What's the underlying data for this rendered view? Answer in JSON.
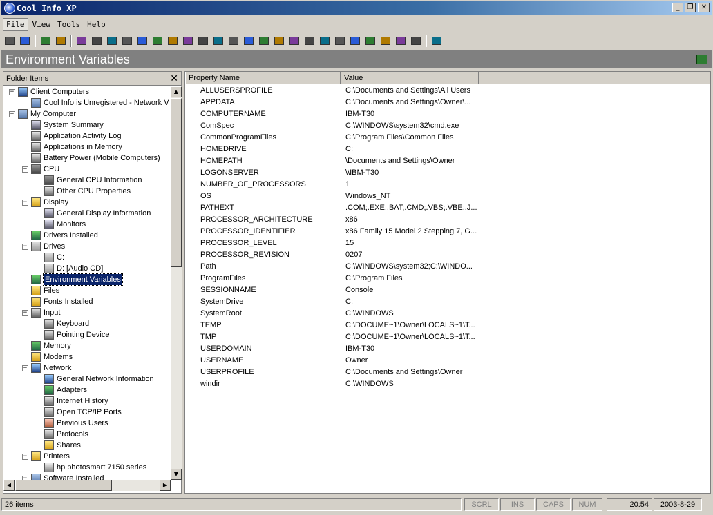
{
  "window": {
    "title": "Cool Info XP",
    "buttons": {
      "minimize": "_",
      "restore": "❐",
      "close": "✕"
    }
  },
  "menu": [
    "File",
    "View",
    "Tools",
    "Help"
  ],
  "header": {
    "title": "Environment Variables"
  },
  "left_pane": {
    "title": "Folder Items",
    "close_glyph": "✕",
    "tree": [
      {
        "label": "Client Computers",
        "level": 0,
        "expander": "−",
        "icon": "ic-network"
      },
      {
        "label": "Cool Info is Unregistered - Network V",
        "level": 1,
        "expander": "",
        "icon": "ic-computer"
      },
      {
        "label": "My Computer",
        "level": 0,
        "expander": "−",
        "icon": "ic-computer"
      },
      {
        "label": "System Summary",
        "level": 1,
        "expander": "",
        "icon": "ic-monitor"
      },
      {
        "label": "Application Activity Log",
        "level": 1,
        "expander": "",
        "icon": "ic-app"
      },
      {
        "label": "Applications in Memory",
        "level": 1,
        "expander": "",
        "icon": "ic-app"
      },
      {
        "label": "Battery Power (Mobile Computers)",
        "level": 1,
        "expander": "",
        "icon": "ic-app"
      },
      {
        "label": "CPU",
        "level": 1,
        "expander": "−",
        "icon": "ic-chip"
      },
      {
        "label": "General CPU Information",
        "level": 2,
        "expander": "",
        "icon": "ic-chip"
      },
      {
        "label": "Other CPU Properties",
        "level": 2,
        "expander": "",
        "icon": "ic-app"
      },
      {
        "label": "Display",
        "level": 1,
        "expander": "−",
        "icon": "ic-folder"
      },
      {
        "label": "General Display Information",
        "level": 2,
        "expander": "",
        "icon": "ic-monitor"
      },
      {
        "label": "Monitors",
        "level": 2,
        "expander": "",
        "icon": "ic-monitor"
      },
      {
        "label": "Drivers Installed",
        "level": 1,
        "expander": "",
        "icon": "ic-green"
      },
      {
        "label": "Drives",
        "level": 1,
        "expander": "−",
        "icon": "ic-drive"
      },
      {
        "label": "C:",
        "level": 2,
        "expander": "",
        "icon": "ic-drive"
      },
      {
        "label": "D: [Audio CD]",
        "level": 2,
        "expander": "",
        "icon": "ic-drive"
      },
      {
        "label": "Environment Variables",
        "level": 1,
        "expander": "",
        "icon": "ic-green",
        "selected": true
      },
      {
        "label": "Files",
        "level": 1,
        "expander": "",
        "icon": "ic-folder"
      },
      {
        "label": "Fonts Installed",
        "level": 1,
        "expander": "",
        "icon": "ic-folder"
      },
      {
        "label": "Input",
        "level": 1,
        "expander": "−",
        "icon": "ic-app"
      },
      {
        "label": "Keyboard",
        "level": 2,
        "expander": "",
        "icon": "ic-app"
      },
      {
        "label": "Pointing Device",
        "level": 2,
        "expander": "",
        "icon": "ic-app"
      },
      {
        "label": "Memory",
        "level": 1,
        "expander": "",
        "icon": "ic-green"
      },
      {
        "label": "Modems",
        "level": 1,
        "expander": "",
        "icon": "ic-folder"
      },
      {
        "label": "Network",
        "level": 1,
        "expander": "−",
        "icon": "ic-network"
      },
      {
        "label": "General Network Information",
        "level": 2,
        "expander": "",
        "icon": "ic-network"
      },
      {
        "label": "Adapters",
        "level": 2,
        "expander": "",
        "icon": "ic-green"
      },
      {
        "label": "Internet History",
        "level": 2,
        "expander": "",
        "icon": "ic-app"
      },
      {
        "label": "Open TCP/IP Ports",
        "level": 2,
        "expander": "",
        "icon": "ic-app"
      },
      {
        "label": "Previous Users",
        "level": 2,
        "expander": "",
        "icon": "ic-user"
      },
      {
        "label": "Protocols",
        "level": 2,
        "expander": "",
        "icon": "ic-app"
      },
      {
        "label": "Shares",
        "level": 2,
        "expander": "",
        "icon": "ic-folder"
      },
      {
        "label": "Printers",
        "level": 1,
        "expander": "−",
        "icon": "ic-folder"
      },
      {
        "label": "hp photosmart 7150 series",
        "level": 2,
        "expander": "",
        "icon": "ic-printer"
      },
      {
        "label": "Software Installed",
        "level": 1,
        "expander": "−",
        "icon": "ic-computer"
      }
    ],
    "scroll": {
      "up": "▲",
      "down": "▼",
      "left": "◀",
      "right": "▶"
    }
  },
  "table": {
    "columns": [
      "Property Name",
      "Value"
    ],
    "rows": [
      [
        "ALLUSERSPROFILE",
        "C:\\Documents and Settings\\All Users"
      ],
      [
        "APPDATA",
        "C:\\Documents and Settings\\Owner\\..."
      ],
      [
        "COMPUTERNAME",
        "IBM-T30"
      ],
      [
        "ComSpec",
        "C:\\WINDOWS\\system32\\cmd.exe"
      ],
      [
        "CommonProgramFiles",
        "C:\\Program Files\\Common Files"
      ],
      [
        "HOMEDRIVE",
        "C:"
      ],
      [
        "HOMEPATH",
        "\\Documents and Settings\\Owner"
      ],
      [
        "LOGONSERVER",
        "\\\\IBM-T30"
      ],
      [
        "NUMBER_OF_PROCESSORS",
        "1"
      ],
      [
        "OS",
        "Windows_NT"
      ],
      [
        "PATHEXT",
        ".COM;.EXE;.BAT;.CMD;.VBS;.VBE;.J..."
      ],
      [
        "PROCESSOR_ARCHITECTURE",
        "x86"
      ],
      [
        "PROCESSOR_IDENTIFIER",
        "x86 Family 15 Model 2 Stepping 7, G..."
      ],
      [
        "PROCESSOR_LEVEL",
        "15"
      ],
      [
        "PROCESSOR_REVISION",
        "0207"
      ],
      [
        "Path",
        "C:\\WINDOWS\\system32;C:\\WINDO..."
      ],
      [
        "ProgramFiles",
        "C:\\Program Files"
      ],
      [
        "SESSIONNAME",
        "Console"
      ],
      [
        "SystemDrive",
        "C:"
      ],
      [
        "SystemRoot",
        "C:\\WINDOWS"
      ],
      [
        "TEMP",
        "C:\\DOCUME~1\\Owner\\LOCALS~1\\T..."
      ],
      [
        "TMP",
        "C:\\DOCUME~1\\Owner\\LOCALS~1\\T..."
      ],
      [
        "USERDOMAIN",
        "IBM-T30"
      ],
      [
        "USERNAME",
        "Owner"
      ],
      [
        "USERPROFILE",
        "C:\\Documents and Settings\\Owner"
      ],
      [
        "windir",
        "C:\\WINDOWS"
      ]
    ]
  },
  "status": {
    "items": "26 items",
    "scrl": "SCRL",
    "ins": "INS",
    "caps": "CAPS",
    "num": "NUM",
    "time": "20:54",
    "date": "2003-8-29"
  },
  "toolbar_icons": [
    "printer-icon",
    "properties-icon",
    "report-icon",
    "export-icon",
    "computer-icon",
    "cpu-icon",
    "display-icon",
    "drivers-icon",
    "drives-icon",
    "env-icon",
    "files-icon",
    "fonts-icon",
    "keyboard-icon",
    "memory-icon",
    "modem-icon",
    "network-icon",
    "adapter-icon",
    "history-icon",
    "ports-icon",
    "users-icon",
    "protocols-icon",
    "shares-icon",
    "printers-icon",
    "software-icon",
    "sound-icon",
    "services-icon",
    "tasks-icon",
    "help-icon"
  ]
}
